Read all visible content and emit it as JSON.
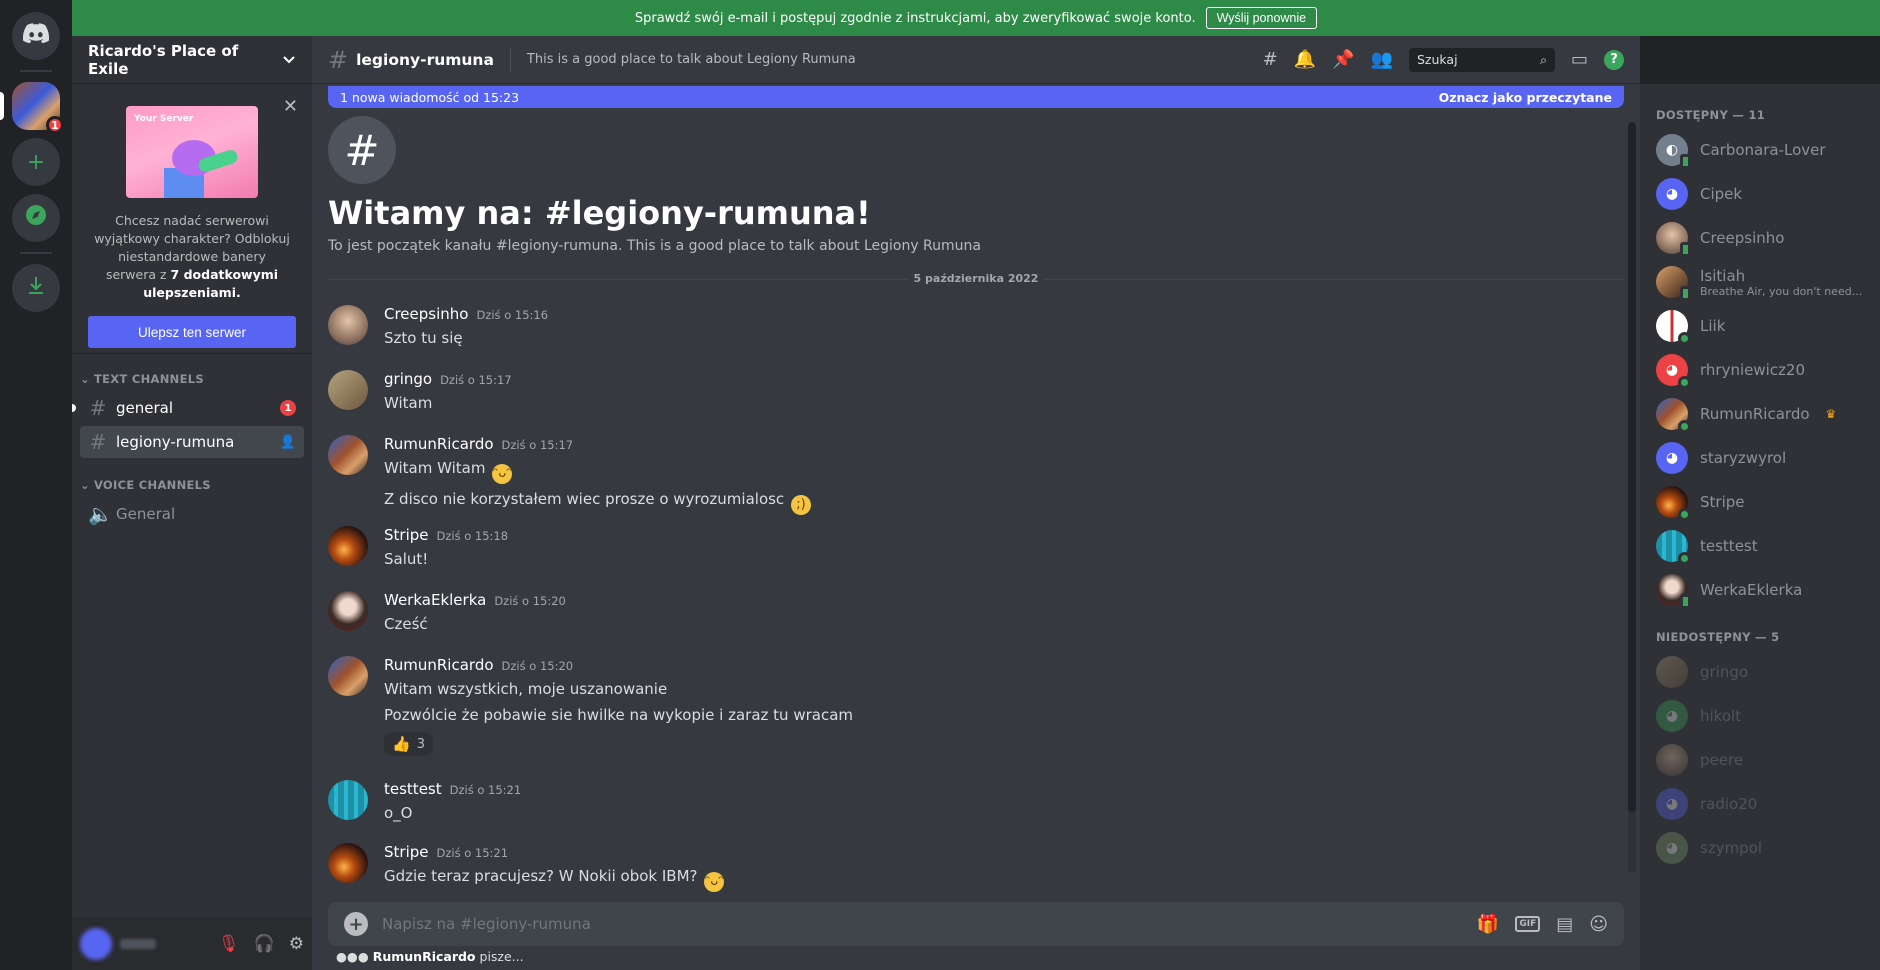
{
  "banner": {
    "text": "Sprawdź swój e-mail i postępuj zgodnie z instrukcjami, aby zweryfikować swoje konto.",
    "button": "Wyślij ponownie"
  },
  "rail": {
    "server_badge": "1"
  },
  "guild": {
    "name": "Ricardo's Place of Exile"
  },
  "boost": {
    "image_label": "Your Server",
    "text_prefix": "Chcesz nadać serwerowi wyjątkowy charakter? Odblokuj niestandardowe banery serwera z",
    "text_bold": "7 dodatkowymi ulepszeniami.",
    "button": "Ulepsz ten serwer"
  },
  "channels": {
    "text_category": "TEXT CHANNELS",
    "voice_category": "VOICE CHANNELS",
    "general": "general",
    "general_badge": "1",
    "active": "legiony-rumuna",
    "voice_general": "General"
  },
  "header": {
    "channel": "legiony-rumuna",
    "topic": "This is a good place to talk about Legiony Rumuna",
    "search_placeholder": "Szukaj"
  },
  "new_bar": {
    "text": "1 nowa wiadomość od 15:23",
    "mark": "Oznacz jako przeczytane"
  },
  "welcome": {
    "title": "Witamy na: #legiony-rumuna!",
    "desc": "To jest początek kanału #legiony-rumuna. This is a good place to talk about Legiony Rumuna"
  },
  "date_sep": "5 października 2022",
  "messages": [
    {
      "author": "Creepsinho",
      "time": "Dziś o 15:16",
      "lines": [
        "Szto tu się"
      ]
    },
    {
      "author": "gringo",
      "time": "Dziś o 15:17",
      "lines": [
        "Witam"
      ]
    },
    {
      "author": "RumunRicardo",
      "time": "Dziś o 15:17",
      "lines": [
        "Witam Witam",
        "Z disco nie korzystałem wiec prosze o wyrozumialosc"
      ]
    },
    {
      "author": "Stripe",
      "time": "Dziś o 15:18",
      "lines": [
        "Salut!"
      ]
    },
    {
      "author": "WerkaEklerka",
      "time": "Dziś o 15:20",
      "lines": [
        "Cześć"
      ]
    },
    {
      "author": "RumunRicardo",
      "time": "Dziś o 15:20",
      "lines": [
        "Witam wszystkich, moje uszanowanie",
        "Pozwólcie że pobawie sie hwilke na wykopie i zaraz tu wracam"
      ],
      "reaction_count": "3"
    },
    {
      "author": "testtest",
      "time": "Dziś o 15:21",
      "lines": [
        "o_O"
      ]
    },
    {
      "author": "Stripe",
      "time": "Dziś o 15:21",
      "lines": [
        "Gdzie teraz pracujesz? W Nokii obok IBM?"
      ]
    }
  ],
  "composer": {
    "placeholder": "Napisz na #legiony-rumuna"
  },
  "typing": {
    "user": "RumunRicardo",
    "suffix": " pisze..."
  },
  "members": {
    "online_header": "DOSTĘPNY — 11",
    "offline_header": "NIEDOSTĘPNY — 5",
    "online": [
      "Carbonara-Lover",
      "Cipek",
      "Creepsinho",
      "Isitiah",
      "Liik",
      "rhryniewicz20",
      "RumunRicardo",
      "staryzwyrol",
      "Stripe",
      "testtest",
      "WerkaEklerka"
    ],
    "isitiah_status": "Breathe Air, you don't need...",
    "offline": [
      "gringo",
      "hikolt",
      "peere",
      "radio20",
      "szympol"
    ]
  },
  "colors": {
    "accent": "#5865f2",
    "online": "#3ba55d",
    "danger": "#ed4245",
    "banner": "#2d8a47"
  }
}
